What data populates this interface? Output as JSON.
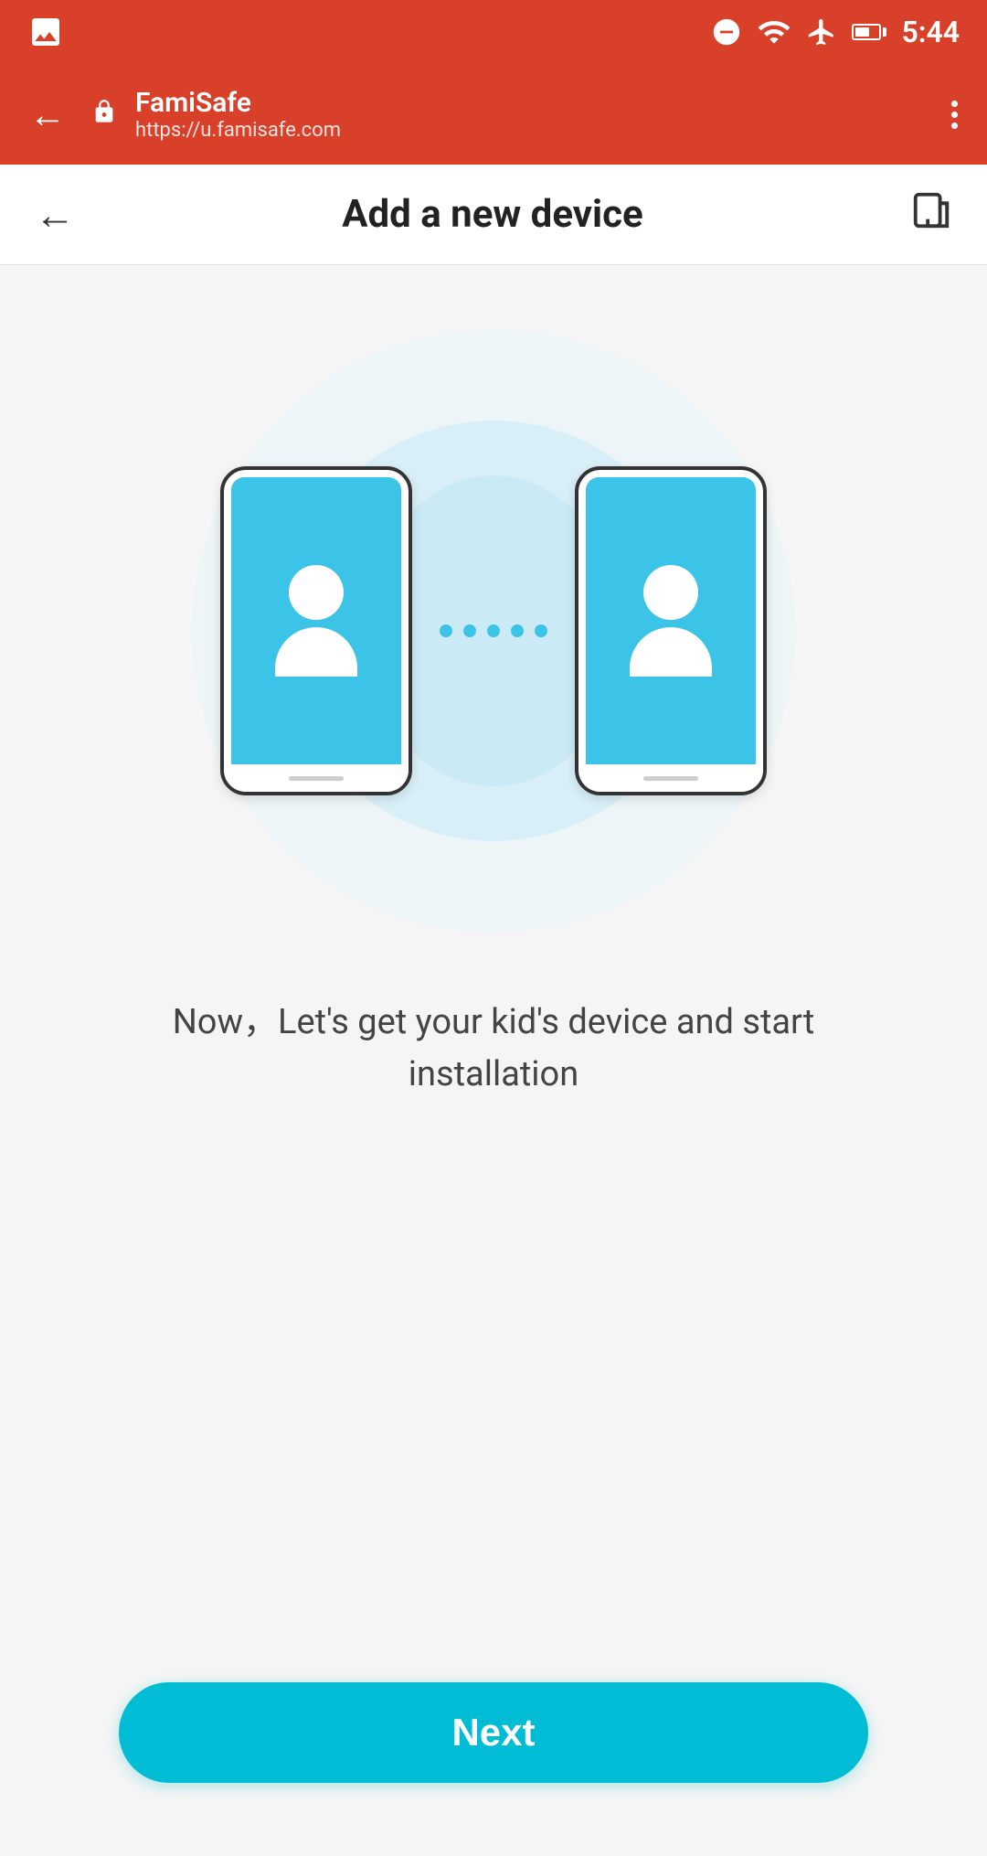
{
  "statusBar": {
    "time": "5:44"
  },
  "browserBar": {
    "title": "FamiSafe",
    "url": "https://u.famisafe.com"
  },
  "pageHeader": {
    "title": "Add a new device"
  },
  "mainContent": {
    "description": "Now，Let's get your kid's device and start installation",
    "nextButton": "Next"
  }
}
